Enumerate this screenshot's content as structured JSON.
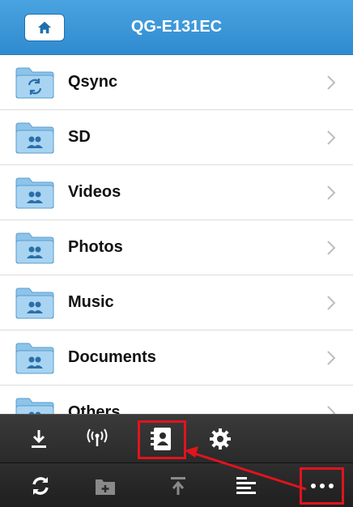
{
  "header": {
    "title": "QG-E131EC",
    "home_icon": "home-icon",
    "color": "#3b96d8"
  },
  "folders": [
    {
      "label": "Qsync",
      "icon": "sync-folder-icon"
    },
    {
      "label": "SD",
      "icon": "shared-folder-icon"
    },
    {
      "label": "Videos",
      "icon": "shared-folder-icon"
    },
    {
      "label": "Photos",
      "icon": "shared-folder-icon"
    },
    {
      "label": "Music",
      "icon": "shared-folder-icon"
    },
    {
      "label": "Documents",
      "icon": "shared-folder-icon"
    },
    {
      "label": "Others",
      "icon": "shared-folder-icon"
    }
  ],
  "toolbar_top": [
    "download-icon",
    "wireless-icon",
    "contacts-icon",
    "settings-icon"
  ],
  "toolbar_bottom": [
    "refresh-icon",
    "new-folder-icon",
    "upload-icon",
    "sort-icon",
    "more-icon"
  ],
  "annotation": {
    "color": "#e0141e",
    "highlighted": [
      "contacts-icon",
      "more-icon"
    ]
  }
}
